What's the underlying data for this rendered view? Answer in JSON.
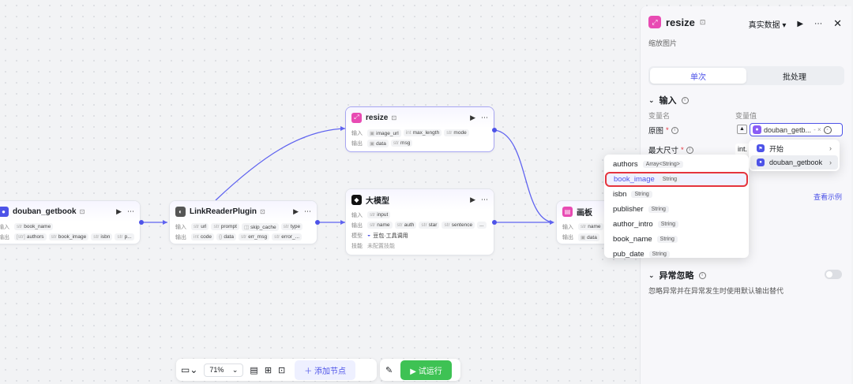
{
  "nodes": {
    "douban": {
      "title": "douban_getbook",
      "in_label": "输入",
      "out_label": "输出",
      "inputs": [
        "book_name"
      ],
      "outputs": [
        "authors",
        "book_image",
        "isbn",
        "p..."
      ]
    },
    "linkreader": {
      "title": "LinkReaderPlugin",
      "in_label": "输入",
      "out_label": "输出",
      "inputs": [
        "url",
        "prompt",
        "skip_cache",
        "type"
      ],
      "outputs": [
        "code",
        "data",
        "err_msg",
        "error_..."
      ]
    },
    "resize": {
      "title": "resize",
      "in_label": "输入",
      "out_label": "输出",
      "inputs": [
        "image_url",
        "max_length",
        "mode"
      ],
      "outputs": [
        "data",
        "msg"
      ]
    },
    "llm": {
      "title": "大模型",
      "in_label": "输入",
      "out_label": "输出",
      "inputs": [
        "input"
      ],
      "outputs": [
        "name",
        "auth",
        "star",
        "sentence",
        "..."
      ],
      "model_label": "模型",
      "model_value": "豆包·工具调用",
      "skill_label": "技能",
      "skill_value": "未配置技能"
    },
    "canvas": {
      "title": "画板",
      "in_label": "输入",
      "out_label": "输出",
      "inputs": [
        "name"
      ],
      "outputs": [
        "data"
      ]
    }
  },
  "toolbar": {
    "zoom": "71%",
    "add_node": "添加节点",
    "run": "试运行"
  },
  "panel": {
    "title": "resize",
    "subtitle": "缩放图片",
    "data_mode": "真实数据",
    "tabs": [
      "单次",
      "批处理"
    ],
    "input_section": "输入",
    "col_name": "变量名",
    "col_value": "变量值",
    "var1_name": "原图",
    "var1_value": "douban_getb...",
    "var2_name": "最大尺寸",
    "var2_value": "int.",
    "view_example": "查看示例",
    "exception_title": "异常忽略",
    "exception_desc": "忽略异常并在异常发生时使用默认输出替代"
  },
  "node_dropdown": [
    {
      "label": "开始"
    },
    {
      "label": "douban_getbook"
    }
  ],
  "field_dropdown": [
    {
      "name": "authors",
      "type": "Array<String>"
    },
    {
      "name": "book_image",
      "type": "String"
    },
    {
      "name": "isbn",
      "type": "String"
    },
    {
      "name": "publisher",
      "type": "String"
    },
    {
      "name": "author_intro",
      "type": "String"
    },
    {
      "name": "book_name",
      "type": "String"
    },
    {
      "name": "pub_date",
      "type": "String"
    }
  ],
  "colors": {
    "accent": "#4d53e8",
    "highlight": "#e5343d",
    "run": "#3ec254"
  },
  "icons": [
    "play-icon",
    "more-icon",
    "close-icon",
    "info-icon",
    "chevron-right-icon",
    "chevron-down-icon",
    "plus-icon",
    "image-icon",
    "expand-icon"
  ]
}
